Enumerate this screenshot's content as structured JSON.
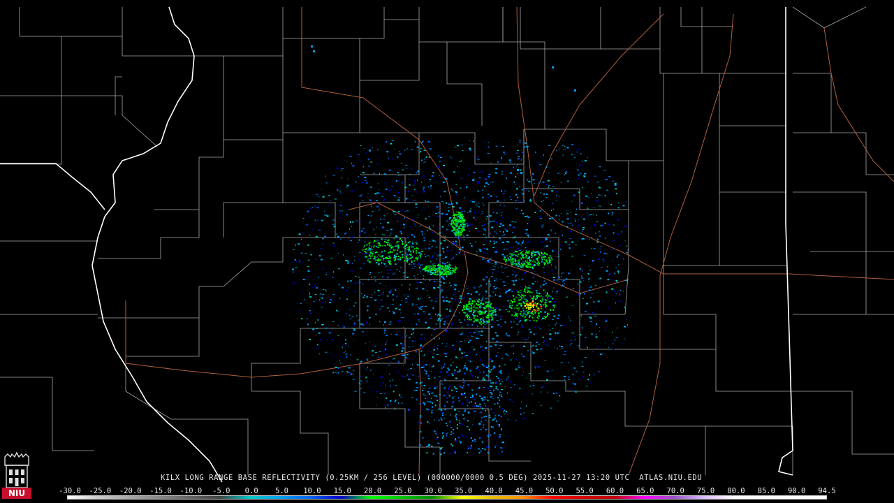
{
  "caption": "KILX LONG RANGE BASE REFLECTIVITY (0.25KM / 256 LEVEL) (000000/0000 0.5 DEG) 2025-11-27 13:20 UTC  ATLAS.NIU.EDU",
  "logo": {
    "text": "NIU",
    "icon": "niu-tower-icon",
    "color": "#c8102e"
  },
  "colorscale": {
    "unit_labels": [
      "-30.0",
      "-25.0",
      "-20.0",
      "-15.0",
      "-10.0",
      "-5.0",
      "0.0",
      "5.0",
      "10.0",
      "15.0",
      "20.0",
      "25.0",
      "30.0",
      "35.0",
      "40.0",
      "45.0",
      "50.0",
      "55.0",
      "60.0",
      "65.0",
      "70.0",
      "75.0",
      "80.0",
      "85.0",
      "90.0",
      "94.5"
    ],
    "colors": [
      "#ffffff",
      "#cccccc",
      "#aaaaaa",
      "#888888",
      "#666666",
      "#444444",
      "#00c8c8",
      "#00a0f0",
      "#0064f0",
      "#0000c8",
      "#00ff00",
      "#00c800",
      "#009000",
      "#ffff00",
      "#e7c000",
      "#ff9000",
      "#ff0000",
      "#d60000",
      "#c00000",
      "#ff00ff",
      "#9955c9",
      "#e0c0ff",
      "#ffffff",
      "#ffffff",
      "#ffffff",
      "#ffffff"
    ]
  },
  "map": {
    "radar_site": "KILX",
    "state_boundary_color": "#ffffff",
    "county_line_color": "#a0a0a0",
    "highway_color": "#b0603c",
    "background": "#000000"
  }
}
